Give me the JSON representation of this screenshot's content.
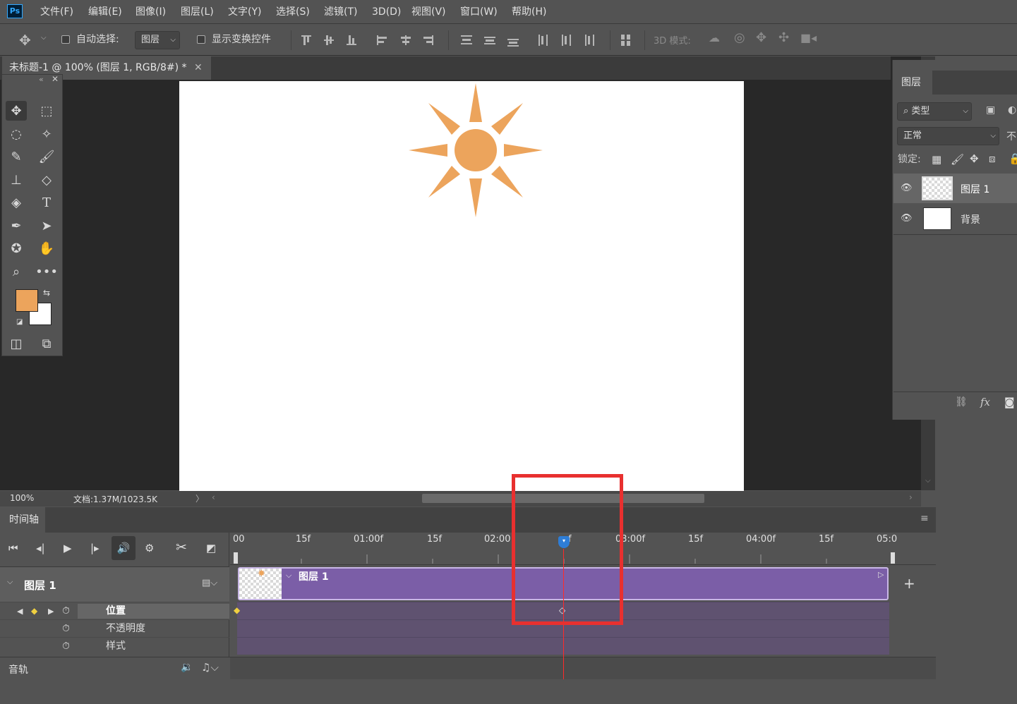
{
  "menubar": {
    "logo": "Ps",
    "items": [
      "文件(F)",
      "编辑(E)",
      "图像(I)",
      "图层(L)",
      "文字(Y)",
      "选择(S)",
      "滤镜(T)",
      "3D(D)",
      "视图(V)",
      "窗口(W)",
      "帮助(H)"
    ]
  },
  "options": {
    "auto_select_label": "自动选择:",
    "auto_select_target": "图层",
    "show_transform_label": "显示变换控件",
    "mode_3d_label": "3D 模式:"
  },
  "document": {
    "tab_title": "未标题-1 @ 100% (图层 1, RGB/8#) *",
    "zoom": "100%",
    "doc_info": "文档:1.37M/1023.5K"
  },
  "colors": {
    "foreground": "#eca45c",
    "background": "#ffffff",
    "sun": "#eca45c",
    "clip": "#7b5ea7",
    "highlight_box": "#e8302f",
    "playhead": "#ff2a2a"
  },
  "layers_panel": {
    "tab": "图层",
    "filter_label": "类型",
    "blend_mode": "正常",
    "opacity_label": "不",
    "lock_label": "锁定:",
    "layers": [
      {
        "name": "图层 1",
        "visible": true,
        "selected": true
      },
      {
        "name": "背景",
        "visible": true,
        "selected": false
      }
    ]
  },
  "timeline": {
    "tab": "时间轴",
    "ruler": [
      "00",
      "15f",
      "01:00f",
      "15f",
      "02:00",
      "f",
      "03:00f",
      "15f",
      "04:00f",
      "15f",
      "05:0"
    ],
    "layer_name": "图层 1",
    "clip_label": "图层 1",
    "properties": [
      "位置",
      "不透明度",
      "样式"
    ],
    "audio_label": "音轨"
  }
}
